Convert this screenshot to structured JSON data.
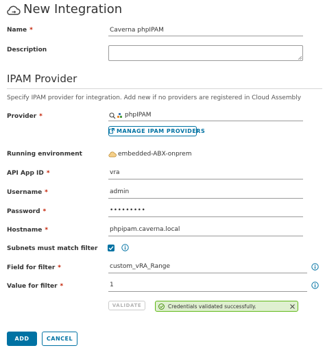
{
  "header": {
    "title": "New Integration",
    "icon": "cloud-sync-icon"
  },
  "form": {
    "name": {
      "label": "Name",
      "value": "Caverna phpIPAM",
      "required": "*"
    },
    "description": {
      "label": "Description",
      "value": ""
    },
    "section_title": "IPAM Provider",
    "hint": "Specify IPAM provider for integration. Add new if no providers are registered in Cloud Assembly",
    "provider": {
      "label": "Provider",
      "value": "phpIPAM",
      "required": "*",
      "manage_label": "MANAGE IPAM PROVIDERS"
    },
    "running_environment": {
      "label": "Running environment",
      "value": "embedded-ABX-onprem"
    },
    "api_app_id": {
      "label": "API App ID",
      "value": "vra",
      "required": "*"
    },
    "username": {
      "label": "Username",
      "value": "admin",
      "required": "*"
    },
    "password": {
      "label": "Password",
      "value": "•••••••••",
      "required": "*"
    },
    "hostname": {
      "label": "Hostname",
      "value": "phpipam.caverna.local",
      "required": "*"
    },
    "subnets_match": {
      "label": "Subnets must match filter",
      "checked": true
    },
    "field_for_filter": {
      "label": "Field for filter",
      "value": "custom_vRA_Range",
      "required": "*"
    },
    "value_for_filter": {
      "label": "Value for filter",
      "value": "1",
      "required": "*"
    },
    "validate_label": "VALIDATE",
    "alert_text": "Credentials validated successfully."
  },
  "footer": {
    "add_label": "ADD",
    "cancel_label": "CANCEL"
  },
  "colors": {
    "primary": "#0072a3",
    "success": "#5eb715",
    "required": "#c21d00"
  }
}
